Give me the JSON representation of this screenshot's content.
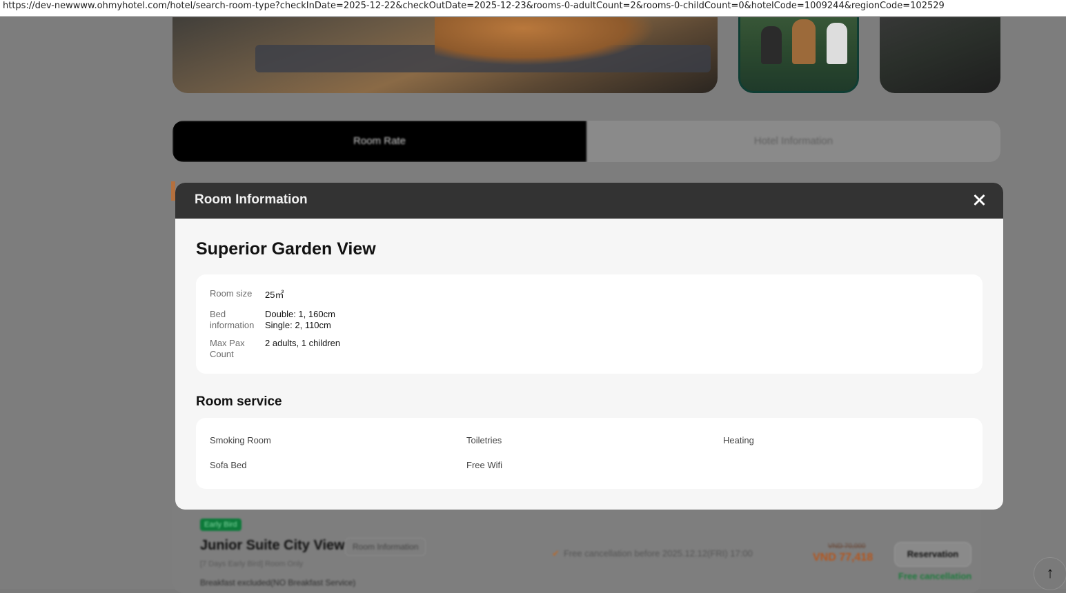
{
  "browser": {
    "url": "https://dev-newwww.ohmyhotel.com/hotel/search-room-type?checkInDate=2025-12-22&checkOutDate=2025-12-23&rooms-0-adultCount=2&rooms-0-childCount=0&hotelCode=1009244&regionCode=102529"
  },
  "tabs": {
    "room_rate": "Room Rate",
    "hotel_information": "Hotel Information"
  },
  "modal": {
    "title": "Room Information",
    "room_name": "Superior Garden View",
    "details": {
      "room_size_label": "Room size",
      "room_size_value": "25㎡",
      "bed_label": "Bed information",
      "bed_line1": "Double: 1, 160cm",
      "bed_line2": "Single: 2, 110cm",
      "max_pax_label": "Max Pax Count",
      "max_pax_value": "2 adults, 1 children"
    },
    "service_title": "Room service",
    "services": [
      "Smoking Room",
      "Toiletries",
      "Heating",
      "Sofa Bed",
      "Free Wifi"
    ]
  },
  "background_card": {
    "badge": "Early Bird",
    "title": "Junior Suite City View",
    "info_button": "Room Information",
    "subtitle": "[7 Days Early Bird] Room Only",
    "breakfast": "Breakfast excluded(NO Breakfast Service)",
    "cancellation": "Free cancellation before 2025.12.12(FRI) 17:00",
    "old_price": "VND 70,000",
    "price": "VND 77,418",
    "reserve_button": "Reservation",
    "free_cancel": "Free cancellation"
  },
  "icons": {
    "close": "close-icon",
    "scroll_top": "arrow-up-icon",
    "check": "check-icon"
  }
}
